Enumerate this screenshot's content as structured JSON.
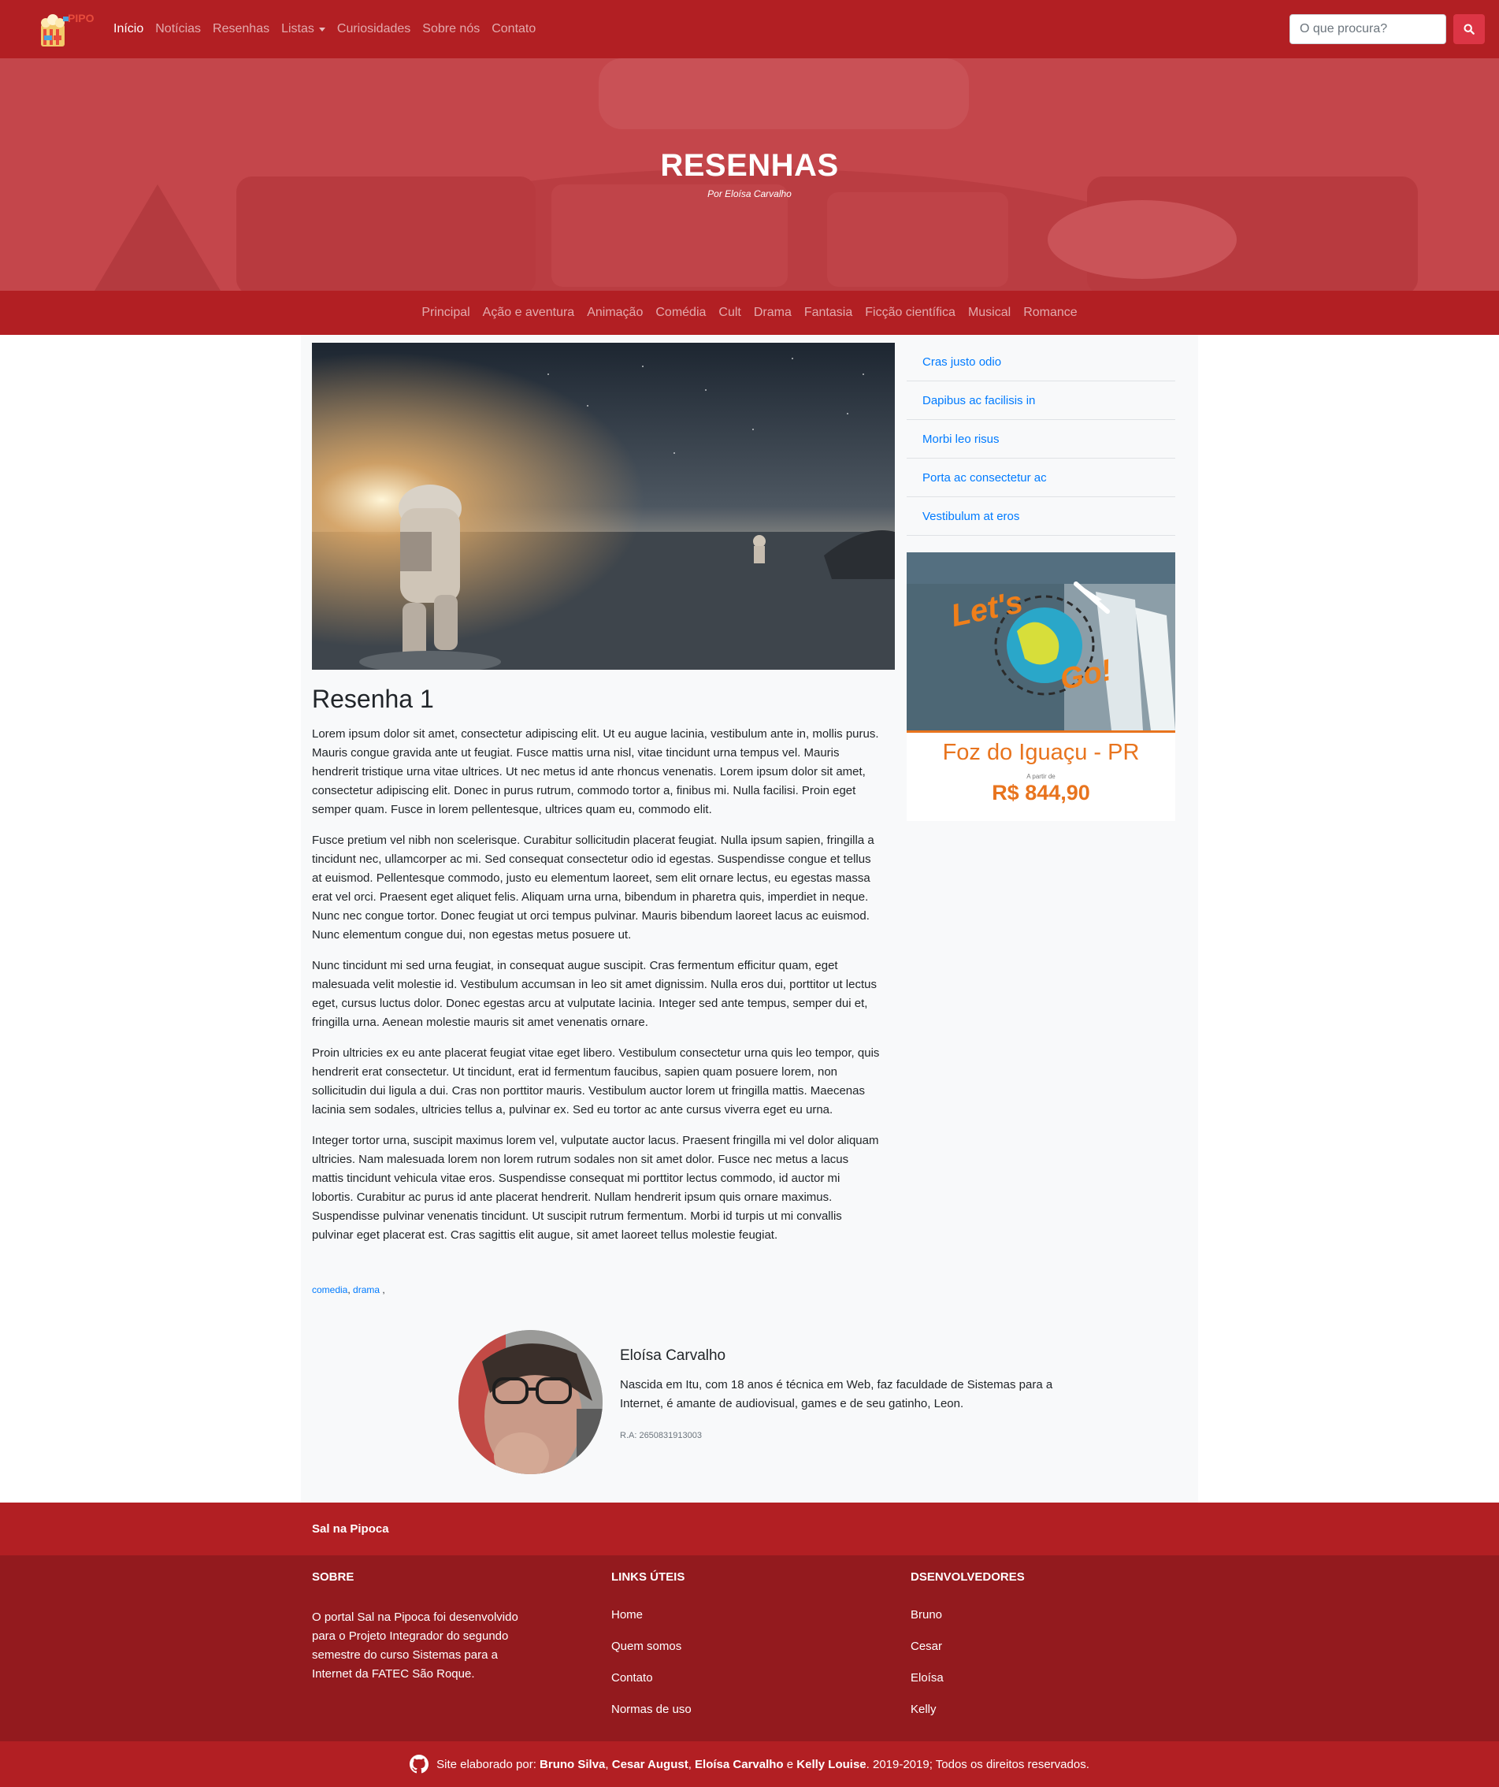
{
  "navbar": {
    "logo_text": "PIPO",
    "links": [
      "Início",
      "Notícias",
      "Resenhas",
      "Listas",
      "Curiosidades",
      "Sobre nós",
      "Contato"
    ],
    "search_placeholder": "O que procura?"
  },
  "hero": {
    "title": "RESENHAS",
    "subtitle": "Por Eloísa Carvalho"
  },
  "categories": [
    "Principal",
    "Ação e aventura",
    "Animação",
    "Comédia",
    "Cult",
    "Drama",
    "Fantasia",
    "Ficção científica",
    "Musical",
    "Romance"
  ],
  "article": {
    "title": "Resenha 1",
    "paragraphs": [
      "Lorem ipsum dolor sit amet, consectetur adipiscing elit. Ut eu augue lacinia, vestibulum ante in, mollis purus. Mauris congue gravida ante ut feugiat. Fusce mattis urna nisl, vitae tincidunt urna tempus vel. Mauris hendrerit tristique urna vitae ultrices. Ut nec metus id ante rhoncus venenatis. Lorem ipsum dolor sit amet, consectetur adipiscing elit. Donec in purus rutrum, commodo tortor a, finibus mi. Nulla facilisi. Proin eget semper quam. Fusce in lorem pellentesque, ultrices quam eu, commodo elit.",
      "Fusce pretium vel nibh non scelerisque. Curabitur sollicitudin placerat feugiat. Nulla ipsum sapien, fringilla a tincidunt nec, ullamcorper ac mi. Sed consequat consectetur odio id egestas. Suspendisse congue et tellus at euismod. Pellentesque commodo, justo eu elementum laoreet, sem elit ornare lectus, eu egestas massa erat vel orci. Praesent eget aliquet felis. Aliquam urna urna, bibendum in pharetra quis, imperdiet in neque. Nunc nec congue tortor. Donec feugiat ut orci tempus pulvinar. Mauris bibendum laoreet lacus ac euismod. Nunc elementum congue dui, non egestas metus posuere ut.",
      "Nunc tincidunt mi sed urna feugiat, in consequat augue suscipit. Cras fermentum efficitur quam, eget malesuada velit molestie id. Vestibulum accumsan in leo sit amet dignissim. Nulla eros dui, porttitor ut lectus eget, cursus luctus dolor. Donec egestas arcu at vulputate lacinia. Integer sed ante tempus, semper dui et, fringilla urna. Aenean molestie mauris sit amet venenatis ornare.",
      "Proin ultricies ex eu ante placerat feugiat vitae eget libero. Vestibulum consectetur urna quis leo tempor, quis hendrerit erat consectetur. Ut tincidunt, erat id fermentum faucibus, sapien quam posuere lorem, non sollicitudin dui ligula a dui. Cras non porttitor mauris. Vestibulum auctor lorem ut fringilla mattis. Maecenas lacinia sem sodales, ultricies tellus a, pulvinar ex. Sed eu tortor ac ante cursus viverra eget eu urna.",
      "Integer tortor urna, suscipit maximus lorem vel, vulputate auctor lacus. Praesent fringilla mi vel dolor aliquam ultricies. Nam malesuada lorem non lorem rutrum sodales non sit amet dolor. Fusce nec metus a lacus mattis tincidunt vehicula vitae eros. Suspendisse consequat mi porttitor lectus commodo, id auctor mi lobortis. Curabitur ac purus id ante placerat hendrerit. Nullam hendrerit ipsum quis ornare maximus. Suspendisse pulvinar venenatis tincidunt. Ut suscipit rutrum fermentum. Morbi id turpis ut mi convallis pulvinar eget placerat est. Cras sagittis elit augue, sit amet laoreet tellus molestie feugiat."
    ],
    "tags": [
      "comedia",
      "drama"
    ],
    "tag_separator": ",",
    "tag_trailing": " ,"
  },
  "sidebar": {
    "links": [
      "Cras justo odio",
      "Dapibus ac facilisis in",
      "Morbi leo risus",
      "Porta ac consectetur ac",
      "Vestibulum at eros"
    ],
    "ad": {
      "logo_text_1": "Let's",
      "logo_text_2": "Go!",
      "city": "Foz do Iguaçu - PR",
      "from": "A partir de",
      "price": "R$ 844,90"
    }
  },
  "author": {
    "name": "Eloísa Carvalho",
    "bio": "Nascida em Itu, com 18 anos é técnica em Web, faz faculdade de Sistemas para a Internet, é amante de audiovisual, games e de seu gatinho, Leon.",
    "ra": "R.A: 2650831913003"
  },
  "footer": {
    "brand": "Sal na Pipoca",
    "sobre": {
      "heading": "SOBRE",
      "text": "O portal Sal na Pipoca foi desenvolvido para o Projeto Integrador do segundo semestre do curso Sistemas para a Internet da FATEC São Roque."
    },
    "links_uteis": {
      "heading": "LINKS ÚTEIS",
      "items": [
        "Home",
        "Quem somos",
        "Contato",
        "Normas de uso"
      ]
    },
    "devs": {
      "heading": "DSENVOLVEDORES",
      "items": [
        "Bruno",
        "Cesar",
        "Eloísa",
        "Kelly"
      ]
    },
    "credits": {
      "prefix": "Site elaborado por: ",
      "names": [
        "Bruno Silva",
        "Cesar August",
        "Eloísa Carvalho",
        "Kelly Louise"
      ],
      "sep1": ", ",
      "sep2": ", ",
      "sep3": " e ",
      "suffix": ". 2019-2019; Todos os direitos reservados."
    }
  },
  "colors": {
    "primary": "#b21f23",
    "footer_dark": "#931a1e",
    "search_button": "#dc3545",
    "link": "#007bff",
    "ad_orange": "#e8741e"
  }
}
